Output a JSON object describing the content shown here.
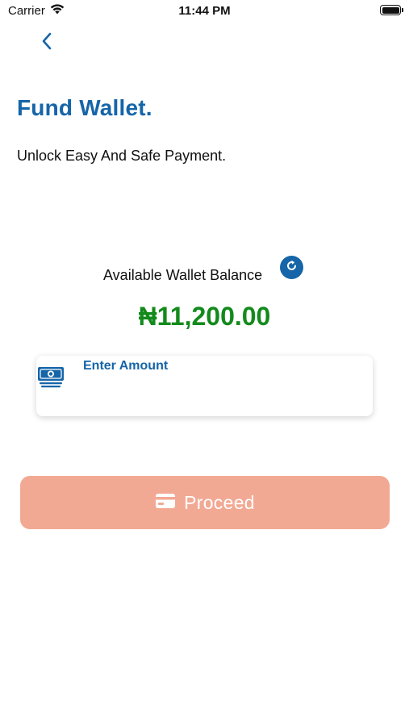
{
  "status_bar": {
    "carrier": "Carrier",
    "time": "11:44 PM"
  },
  "header": {
    "title": "Fund Wallet.",
    "subtitle": "Unlock Easy And Safe Payment."
  },
  "balance": {
    "label": "Available Wallet Balance",
    "amount": "₦11,200.00"
  },
  "amount_field": {
    "label": "Enter Amount",
    "value": ""
  },
  "proceed_button": {
    "label": "Proceed"
  },
  "colors": {
    "primary_blue": "#1565a8",
    "balance_green": "#138a1c",
    "proceed_disabled": "#f2a994"
  },
  "icons": {
    "back": "chevron-left-icon",
    "wifi": "wifi-icon",
    "battery": "battery-icon",
    "refresh": "refresh-icon",
    "money": "money-stack-icon",
    "card": "credit-card-icon"
  }
}
